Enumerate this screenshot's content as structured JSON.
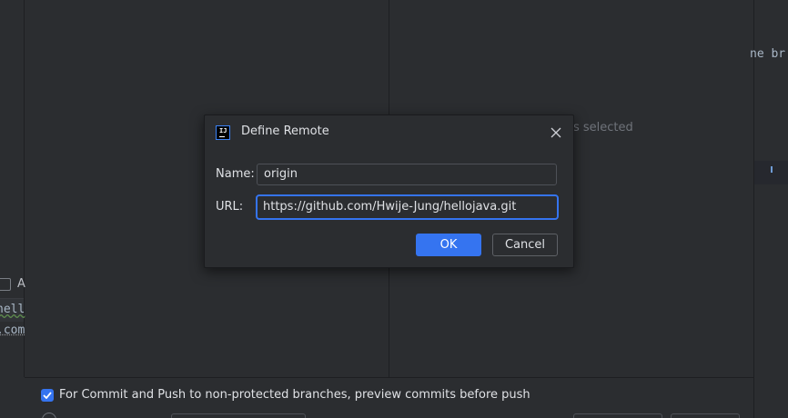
{
  "background": {
    "right_pane_text_fragment": "ne br",
    "empty_state_text": "s selected",
    "left_checkbox_label": "A",
    "left_code_line1": "hell",
    "left_code_line2": ".com"
  },
  "bottom": {
    "preview_checkbox_checked": true,
    "preview_checkbox_label": "For Commit and Push to non-protected branches, preview commits before push"
  },
  "dialog": {
    "icon": "intellij-idea-icon",
    "icon_text": "IJ",
    "title": "Define Remote",
    "close_icon": "close-icon",
    "name_label": "Name:",
    "name_value": "origin",
    "url_label": "URL:",
    "url_value": "https://github.com/Hwije-Jung/hellojava.git",
    "ok_label": "OK",
    "cancel_label": "Cancel"
  },
  "colors": {
    "accent": "#3574f0",
    "background": "#2b2d30",
    "text": "#dfe1e5"
  }
}
